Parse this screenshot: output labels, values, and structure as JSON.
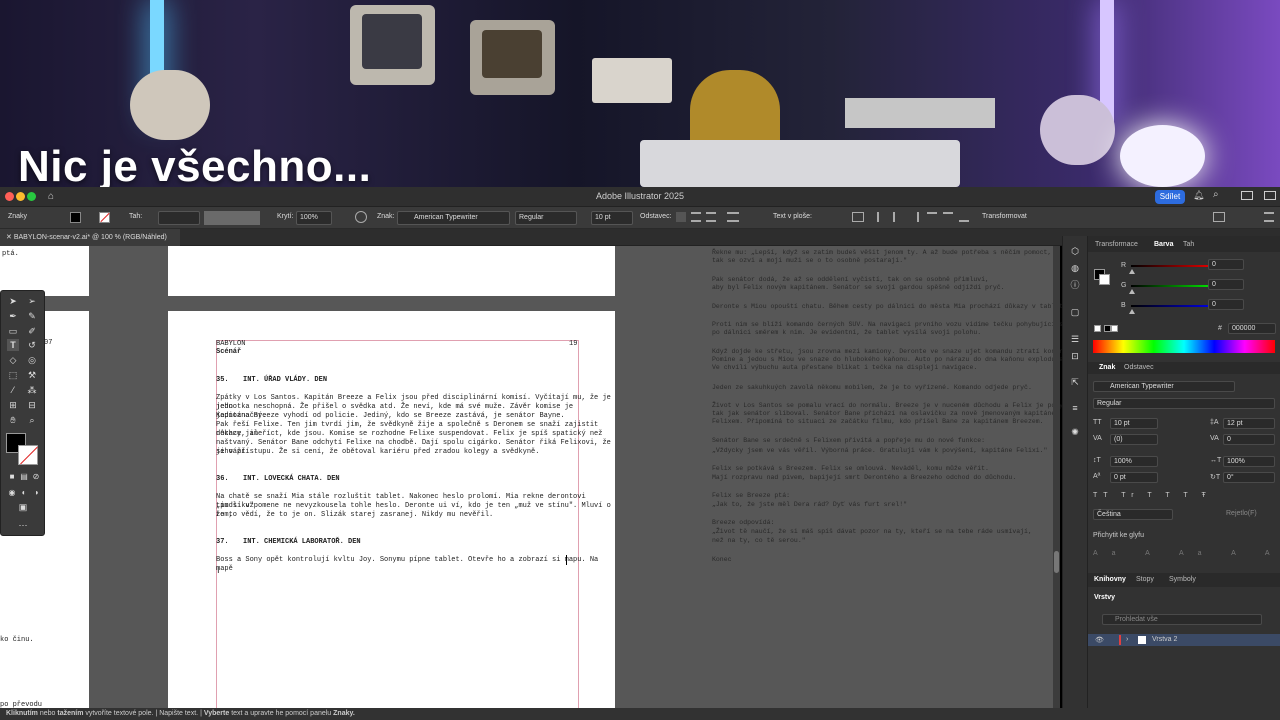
{
  "overlay": {
    "title": "Nic je všechno..."
  },
  "window": {
    "title": "Adobe Illustrator 2025",
    "share_label": "Sdílet"
  },
  "controlbar": {
    "mode": "Znaky",
    "stroke_label": "Tah:",
    "opacity_label": "Krytí:",
    "opacity_value": "100%",
    "char_label": "Znak:",
    "font": "American Typewriter",
    "style": "Regular",
    "size": "10 pt",
    "paragraph_label": "Odstavec:",
    "text_on_path": "Text v ploše:",
    "transform": "Transformovat"
  },
  "document": {
    "tab": "BABYLON-scenar-v2.ai* @ 100 % (RGB/Náhled)"
  },
  "page": {
    "header_left": "BABYLON",
    "header_sub": "Scénář",
    "page_number": "19",
    "scenes": [
      {
        "number": "35.",
        "title": "INT. ÚŘAD VLÁDY. DEN",
        "body": [
          "Zpátky v Los Santos. Kapitán Breeze a Felix jsou před disciplinární komisí. Vyčítají mu, že je jeho",
          "jednotka neschopná. Že přišel o svědka atd. Že neví, kde má své muže. Závěr komise je jednoznačný.",
          "Kapitána Breeze vyhodí od policie. Jediný, kdo se Breeze zastává, je senátor Bayne.",
          "Pak řeší Felixe. Ten jim tvrdí jim, že svědkyně žije a společně s Deronem se snaží zajistit důkazy, ale",
          "nechce jim říct, kde jsou. Komise se rozhodne Felixe suspendovat. Felix je spíš spatický než",
          "naštvaný. Senátor Bane odchytí Felixe na chodbě. Dají spolu cigárko. Senátor řiká Felixovi, že si váží",
          "jeho přístupu. Že si cení, že obětoval kariéru před zradou kolegy a svědkyně."
        ]
      },
      {
        "number": "36.",
        "title": "INT. LOVECKÁ CHATA. DEN",
        "body": [
          "Na chatě se snaží Mia stále rozluštit tablet. Nakonec heslo prolomí. Mia rekne derontovi „pudlíku\"",
          "tim si vzpomene ne nevyzkousela tohle heslo.  Deronte ui ví, kdo je ten „muž ve stínu\". Mluví o tom,",
          "že to vědí, že to je on. Slizák starej zasranej. Nikdy mu nevěřil."
        ]
      },
      {
        "number": "37.",
        "title": "INT. CHEMICKÁ LABORATOŘ. DEN",
        "body": [
          "Boss a Sony opět kontrolují kvltu Joy. Sonymu pípne tablet. Otevře ho a zobrazí si mapu. Na mapě"
        ]
      }
    ],
    "top_page_fragment": "ptá.",
    "left_fragment_1": "07",
    "left_fragment_2": "ko činu.",
    "left_fragment_3": "po převodu"
  },
  "background_text": [
    "Řekne mu: „Lepší, když se zatím budeš věšit jenom ty. A až bude potřeba s něčím pomoct,",
    "tak se ozvi a moji muži se o to osobně postarají.\"",
    "",
    "Pak senátor dodá, že až se oddělení vyčistí, tak on se osobně přimluví,",
    "aby byl Felix novým kapitánem. Senátor se svojí gardou spěšně odjíždí pryč.",
    "",
    "Deronte s Miou opouští chatu. Během cesty po dálnici do města Mia prochází důkazy v tabletu.",
    "",
    "Proti nim se blíží komando černých SUV. Na navigaci prvního vozu vidíme tečku pohybující se",
    "po dálnici směrem k nim. Je evidentní, že tablet vysílá svoji polohu.",
    "",
    "Když dojde ke střetu, jsou zrovna mezi kamiony. Deronte ve snaze ujet komandu ztratí kontrolu.",
    "Pomine a jedou s Miou ve snaze do hlubokého kaňonu. Auto po nárazu do dna kaňonu exploduje.",
    "Ve chvíli výbuchu auta přestane blikat i tečka na displeji navigace.",
    "",
    "Jeden ze sakuhkuých zavolá někomu mobilem, že je to vyřízené. Komando odjede pryč.",
    "",
    "Život v Los Santos se pomalu vrací do normálu. Breeze je v nuceném důchodu a Felix je povyšen,",
    "tak jak senátor slíboval. Senátor Bane přichází na oslavičku za nově jmenovaným kapitánem",
    "Felixem. Připomíná to situaci ze začátku filmu, kdo přišel Bane za kapitánem Breezem.",
    "",
    "Senátor Bane se srdečně s Felixem přivítá a popřeje mu do nové funkce:",
    "„Vždycky jsem ve vás věřil. Výborná práce. Gratuluji vám k povýšení, kapitáne Felixi.\"",
    "",
    "Felix se potkává s Breezem. Felix se omlouvá. Neväděl, komu může věřit.",
    "Mají rozpravu nad pivem, bapijejí smrt Derontého a Breezeho odchod do důchodu.",
    "",
    "Felix se Breeze ptá:",
    "„Jak to, že jste měl Dera rád? Dyť vás furt srel!\"",
    "",
    "Breeze odpovídá:",
    "„Život tě naučí, že si máš spíš dávat pozor na ty, kteří se na tebe ráde usmívají,",
    "než na ty, co tě serou.\"",
    "",
    "Konec"
  ],
  "right_panel": {
    "tabs1": [
      "Transformace",
      "Barva",
      "Tah"
    ],
    "rgb": {
      "R": "0",
      "G": "0",
      "B": "0",
      "hex": "000000"
    },
    "tabs2": [
      "Znak",
      "Odstavec"
    ],
    "font": "American Typewriter",
    "style": "Regular",
    "size": "10 pt",
    "leading": "12 pt",
    "kerning": "(0)",
    "tracking": "0",
    "scale_v": "100%",
    "scale_h": "100%",
    "baseline": "0 pt",
    "rotation": "0°",
    "language": "Čeština",
    "language_right": "Rejetlo(F)",
    "snap": "Přichytit ke glyfu",
    "tabs3": [
      "Knihovny",
      "Stopy",
      "Symboly"
    ],
    "layers_title": "Vrstvy",
    "layers_search": "Prohledat vše",
    "layer_name": "Vrstva 2"
  },
  "status": {
    "seg1a": "Kliknutím",
    "seg1b": " nebo ",
    "seg1c": "tažením",
    "seg1d": " vytvoříte textové pole.",
    "seg2": "Napište text.",
    "seg3a": "Vyberte",
    "seg3b": " text a upravte he pomocí panelu ",
    "seg3c": "Znaky."
  },
  "colors": {
    "accent": "#2d6cdf",
    "guide": "#e0a0b0"
  }
}
